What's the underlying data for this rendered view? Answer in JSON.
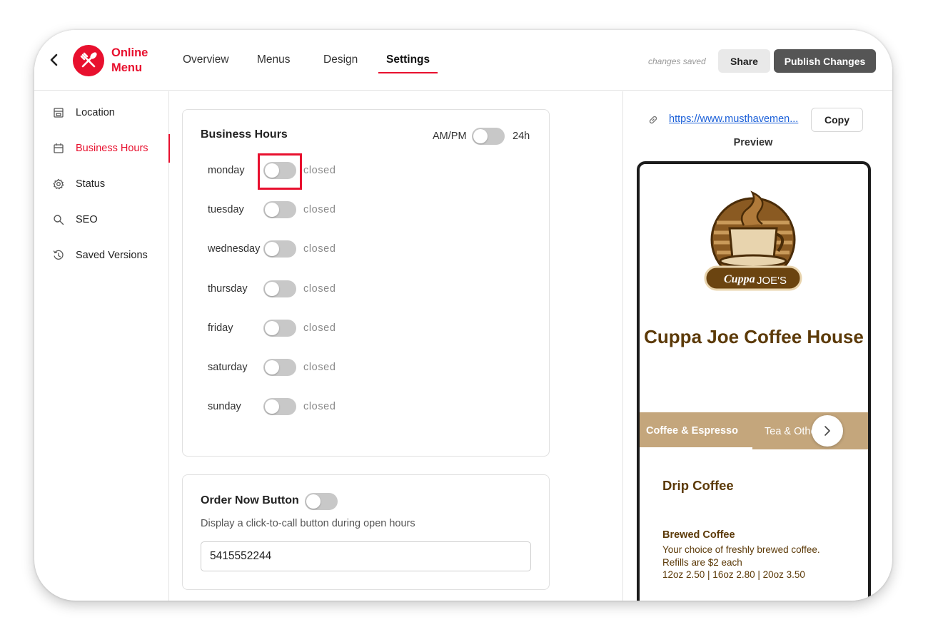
{
  "header": {
    "logo_line1": "Online",
    "logo_line2": "Menu",
    "tabs": [
      {
        "label": "Overview"
      },
      {
        "label": "Menus"
      },
      {
        "label": "Design"
      },
      {
        "label": "Settings",
        "active": true
      }
    ],
    "save_status": "changes saved",
    "share_label": "Share",
    "publish_label": "Publish Changes"
  },
  "sidebar": {
    "items": [
      {
        "label": "Location",
        "icon": "store-icon"
      },
      {
        "label": "Business Hours",
        "icon": "calendar-icon",
        "active": true
      },
      {
        "label": "Status",
        "icon": "gear-icon"
      },
      {
        "label": "SEO",
        "icon": "search-icon"
      },
      {
        "label": "Saved Versions",
        "icon": "history-icon"
      }
    ]
  },
  "business_hours": {
    "title": "Business Hours",
    "format_left": "AM/PM",
    "format_right": "24h",
    "format_24h": false,
    "days": [
      {
        "name": "monday",
        "status": "closed",
        "open": false
      },
      {
        "name": "tuesday",
        "status": "closed",
        "open": false
      },
      {
        "name": "wednesday",
        "status": "closed",
        "open": false
      },
      {
        "name": "thursday",
        "status": "closed",
        "open": false
      },
      {
        "name": "friday",
        "status": "closed",
        "open": false
      },
      {
        "name": "saturday",
        "status": "closed",
        "open": false
      },
      {
        "name": "sunday",
        "status": "closed",
        "open": false
      }
    ]
  },
  "order_now": {
    "title": "Order Now Button",
    "enabled": false,
    "description": "Display a click-to-call button during open hours",
    "phone_value": "5415552244"
  },
  "preview": {
    "url": "https://www.musthavemen...",
    "copy_label": "Copy",
    "label": "Preview",
    "logo_text_1": "Cuppa",
    "logo_text_2": "JOE'S",
    "business_name": "Cuppa Joe Coffee House",
    "categories": [
      "Coffee & Espresso",
      "Tea & Other D"
    ],
    "section_title": "Drip Coffee",
    "item_name": "Brewed Coffee",
    "item_description": "Your choice of freshly brewed coffee. Refills are $2 each",
    "item_prices": "12oz 2.50 | 16oz 2.80 | 20oz 3.50"
  },
  "colors": {
    "accent": "#e8102e",
    "brand_brown": "#5c3a08",
    "category_bar": "#c4a67c",
    "publish_button": "#555555"
  }
}
